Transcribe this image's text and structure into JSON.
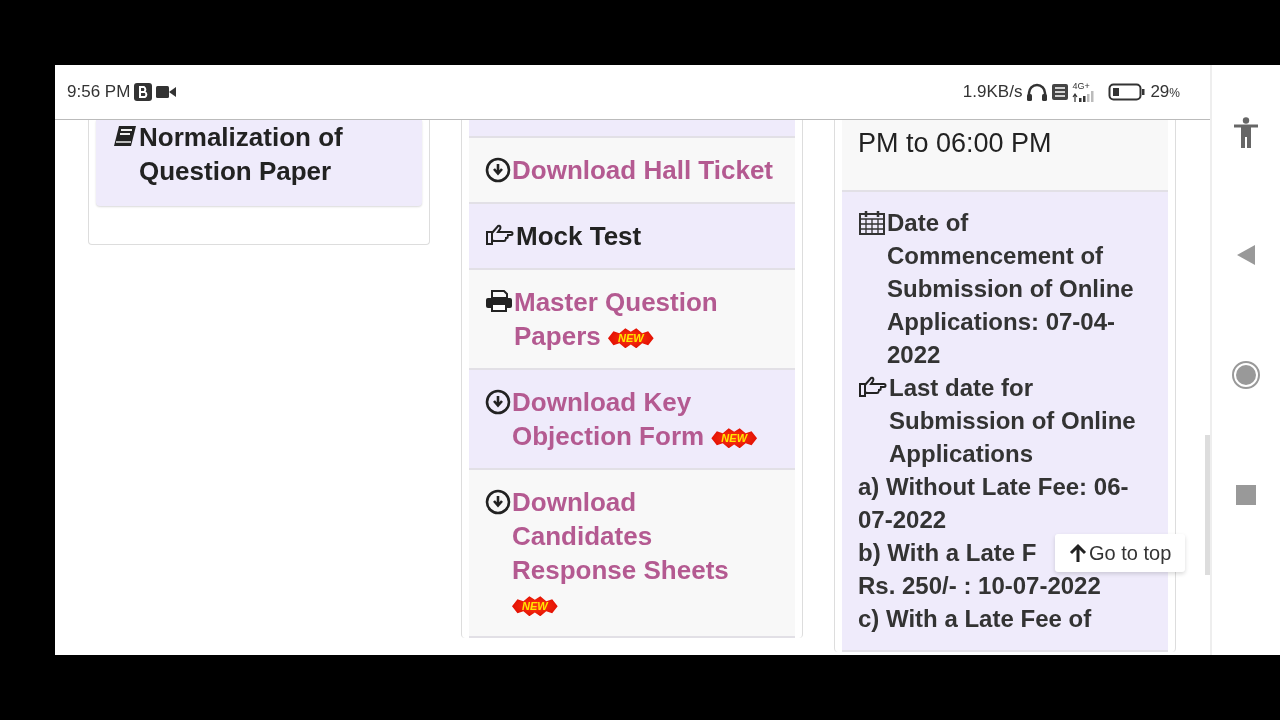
{
  "status_bar": {
    "time": "9:56 PM",
    "network_speed": "1.9KB/s",
    "network_type": "4G+",
    "battery": "29",
    "battery_unit": "%"
  },
  "columns": [
    {
      "items": [
        {
          "kind": "book",
          "color": "#efebfb",
          "text": "Normalization of Question Paper"
        }
      ]
    },
    {
      "items": [
        {
          "kind": "blank",
          "color": "#efebfb"
        },
        {
          "kind": "download",
          "color": "#f8f8f8",
          "text": "Download Hall Ticket"
        },
        {
          "kind": "pointer",
          "color": "#efebfb",
          "text": "Mock Test"
        },
        {
          "kind": "printer",
          "color": "#f8f8f8",
          "text": "Master Question Papers",
          "badge": "NEW"
        },
        {
          "kind": "download",
          "color": "#efebfb",
          "text": "Download Key Objection Form",
          "badge": "NEW"
        },
        {
          "kind": "download",
          "color": "#f8f8f8",
          "text": "Download Candidates Response Sheets",
          "badge": "NEW"
        }
      ]
    },
    {
      "items": [
        {
          "kind": "timing",
          "color": "#f8f8f8",
          "lines": [
            {
              "text": "PM to 06:00 PM"
            }
          ]
        },
        {
          "kind": "dates",
          "color": "#efebfb",
          "lines": [
            {
              "kind": "calendar",
              "text": "Date of Commencement of Submission of Online Applications: 07-04-2022"
            },
            {
              "kind": "pointer",
              "text": "Last date for Submission of Online Applications"
            },
            {
              "text": "a) Without Late Fee: 06-07-2022"
            },
            {
              "text": "b) With a Late F",
              "overlay": "Go to top"
            },
            {
              "text": "Rs. 250/- : 10-07-2022"
            },
            {
              "text": "c) With a Late Fee of"
            }
          ]
        }
      ]
    }
  ]
}
